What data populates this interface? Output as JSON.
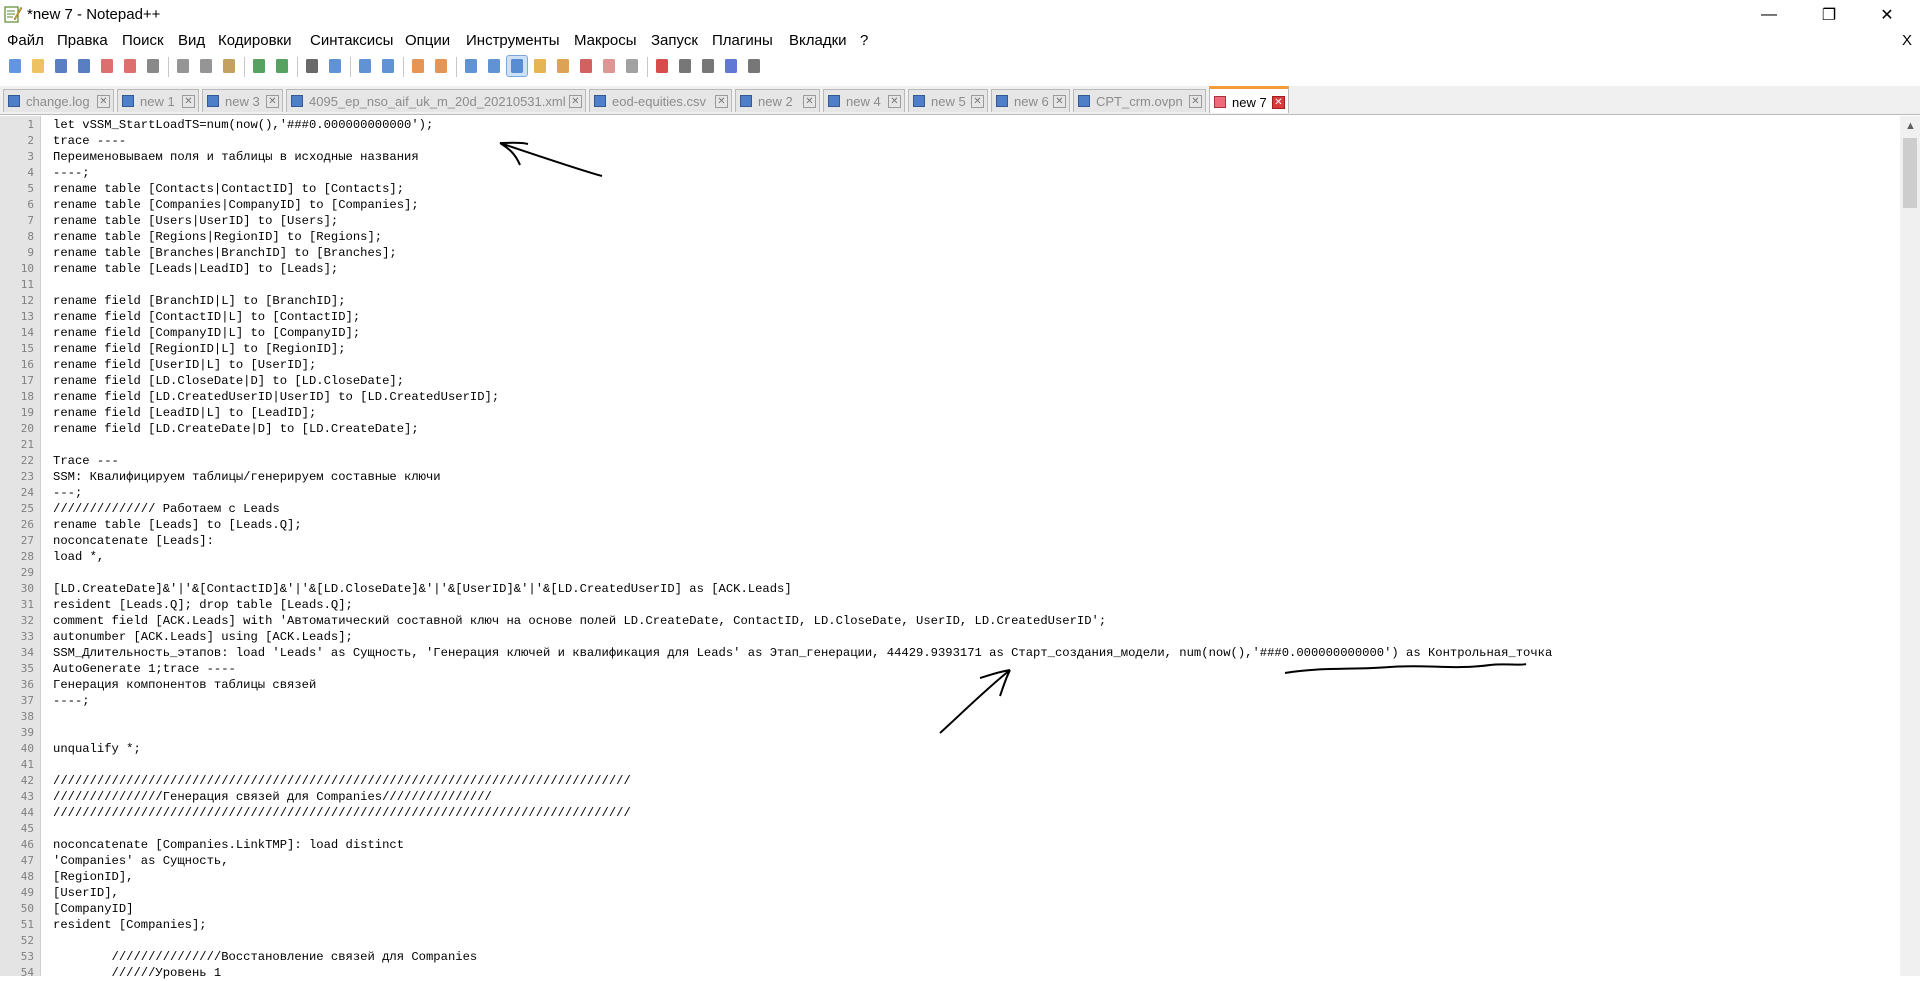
{
  "window": {
    "title": "*new 7 - Notepad++",
    "minimize": "—",
    "maximize": "❐",
    "close": "✕"
  },
  "menu": {
    "items": [
      "Файл",
      "Правка",
      "Поиск",
      "Вид",
      "Кодировки",
      "Синтаксисы",
      "Опции",
      "Инструменты",
      "Макросы",
      "Запуск",
      "Плагины",
      "Вкладки",
      "?"
    ],
    "close_doc": "X"
  },
  "toolbar": {
    "buttons": [
      {
        "icon": "new-file-icon",
        "color": "#3b7dd8"
      },
      {
        "icon": "open-file-icon",
        "color": "#e8b33c"
      },
      {
        "icon": "save-icon",
        "color": "#2f5fb3"
      },
      {
        "icon": "save-all-icon",
        "color": "#2f5fb3"
      },
      {
        "icon": "close-icon",
        "color": "#d44b4b"
      },
      {
        "icon": "close-all-icon",
        "color": "#d44b4b"
      },
      {
        "icon": "print-icon",
        "color": "#6b6b6b"
      },
      {
        "icon": "cut-icon",
        "color": "#7a7a7a"
      },
      {
        "icon": "copy-icon",
        "color": "#7a7a7a"
      },
      {
        "icon": "paste-icon",
        "color": "#b58a3c"
      },
      {
        "icon": "undo-icon",
        "color": "#2e8b3a"
      },
      {
        "icon": "redo-icon",
        "color": "#2e8b3a"
      },
      {
        "icon": "find-icon",
        "color": "#444444"
      },
      {
        "icon": "replace-icon",
        "color": "#3a78c9"
      },
      {
        "icon": "zoom-in-icon",
        "color": "#3a78c9"
      },
      {
        "icon": "zoom-out-icon",
        "color": "#3a78c9"
      },
      {
        "icon": "sync-vertical-icon",
        "color": "#e07b2a"
      },
      {
        "icon": "sync-horizontal-icon",
        "color": "#e07b2a"
      },
      {
        "icon": "word-wrap-icon",
        "color": "#3a78c9"
      },
      {
        "icon": "show-all-chars-icon",
        "color": "#3a78c9"
      },
      {
        "icon": "indent-guide-icon",
        "color": "#3a78c9"
      },
      {
        "icon": "udl-icon",
        "color": "#e0a02a"
      },
      {
        "icon": "doc-map-icon",
        "color": "#d38b2a"
      },
      {
        "icon": "function-list-icon",
        "color": "#c93a3a"
      },
      {
        "icon": "folder-workspace-icon",
        "color": "#d87a7a"
      },
      {
        "icon": "monitoring-icon",
        "color": "#8a8a8a"
      },
      {
        "icon": "record-macro-icon",
        "color": "#d01f1f"
      },
      {
        "icon": "stop-macro-icon",
        "color": "#555555"
      },
      {
        "icon": "play-macro-icon",
        "color": "#555555"
      },
      {
        "icon": "run-macro-multiple-icon",
        "color": "#3a58c9"
      },
      {
        "icon": "save-macro-icon",
        "color": "#555555"
      }
    ]
  },
  "tabs": [
    {
      "label": "change.log",
      "color": "blue"
    },
    {
      "label": "new 1",
      "color": "blue"
    },
    {
      "label": "new 3",
      "color": "blue"
    },
    {
      "label": "4095_ep_nso_aif_uk_m_20d_20210531.xml",
      "color": "blue"
    },
    {
      "label": "eod-equities.csv",
      "color": "blue"
    },
    {
      "label": "new 2",
      "color": "blue"
    },
    {
      "label": "new 4",
      "color": "blue"
    },
    {
      "label": "new 5",
      "color": "blue"
    },
    {
      "label": "new 6",
      "color": "blue"
    },
    {
      "label": "CPT_crm.ovpn",
      "color": "blue"
    },
    {
      "label": "new 7",
      "color": "red",
      "active": true
    }
  ],
  "editor": {
    "lines": [
      "let vSSM_StartLoadTS=num(now(),'###0.000000000000');",
      "trace ----",
      "Переименовываем поля и таблицы в исходные названия",
      "----;",
      "rename table [Contacts|ContactID] to [Contacts];",
      "rename table [Companies|CompanyID] to [Companies];",
      "rename table [Users|UserID] to [Users];",
      "rename table [Regions|RegionID] to [Regions];",
      "rename table [Branches|BranchID] to [Branches];",
      "rename table [Leads|LeadID] to [Leads];",
      "",
      "rename field [BranchID|L] to [BranchID];",
      "rename field [ContactID|L] to [ContactID];",
      "rename field [CompanyID|L] to [CompanyID];",
      "rename field [RegionID|L] to [RegionID];",
      "rename field [UserID|L] to [UserID];",
      "rename field [LD.CloseDate|D] to [LD.CloseDate];",
      "rename field [LD.CreatedUserID|UserID] to [LD.CreatedUserID];",
      "rename field [LeadID|L] to [LeadID];",
      "rename field [LD.CreateDate|D] to [LD.CreateDate];",
      "",
      "Trace ---",
      "SSM: Квалифицируем таблицы/генерируем составные ключи",
      "---;",
      "////////////// Работаем с Leads",
      "rename table [Leads] to [Leads.Q];",
      "noconcatenate [Leads]:",
      "load *,",
      "",
      "[LD.CreateDate]&'|'&[ContactID]&'|'&[LD.CloseDate]&'|'&[UserID]&'|'&[LD.CreatedUserID] as [ACK.Leads]",
      "resident [Leads.Q]; drop table [Leads.Q];",
      "comment field [ACK.Leads] with 'Автоматический составной ключ на основе полей LD.CreateDate, ContactID, LD.CloseDate, UserID, LD.CreatedUserID';",
      "autonumber [ACK.Leads] using [ACK.Leads];",
      "SSM_Длительность_этапов: load 'Leads' as Сущность, 'Генерация ключей и квалификация для Leads' as Этап_генерации, 44429.9393171 as Старт_создания_модели, num(now(),'###0.000000000000') as Контрольная_точка",
      "AutoGenerate 1;trace ----",
      "Генерация компонентов таблицы связей",
      "----;",
      "",
      "",
      "unqualify *;",
      "",
      "///////////////////////////////////////////////////////////////////////////////",
      "///////////////Генерация связей для Companies///////////////",
      "///////////////////////////////////////////////////////////////////////////////",
      "",
      "noconcatenate [Companies.LinkTMP]: load distinct",
      "'Companies' as Сущность,",
      "[RegionID],",
      "[UserID],",
      "[CompanyID]",
      "resident [Companies];",
      "",
      "        ///////////////Восстановление связей для Companies",
      "        //////Уровень 1"
    ]
  }
}
